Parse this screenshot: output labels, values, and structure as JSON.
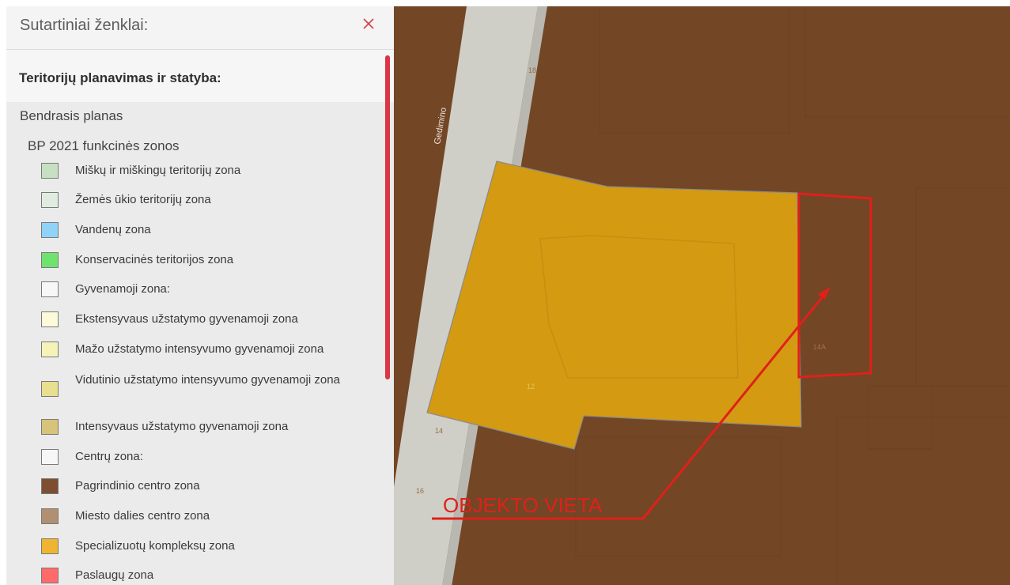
{
  "panel": {
    "title": "Sutartiniai ženklai:",
    "section": "Teritorijų planavimas ir statyba:",
    "group": "Bendrasis planas",
    "subgroup": "BP 2021 funkcinės zonos",
    "close_icon": "close-icon"
  },
  "legend": [
    {
      "label": "Miškų ir miškingų teritorijų zona",
      "color": "#c8e0c2"
    },
    {
      "label": "Žemės ūkio teritorijų zona",
      "color": "#e1ece0"
    },
    {
      "label": "Vandenų zona",
      "color": "#8fd4f8"
    },
    {
      "label": "Konservacinės teritorijos zona",
      "color": "#6fe36f"
    },
    {
      "label": "Gyvenamoji zona:",
      "color": "#f7f7f7"
    },
    {
      "label": "Ekstensyvaus užstatymo gyvenamoji zona",
      "color": "#fbfbd9"
    },
    {
      "label": "Mažo užstatymo intensyvumo gyvenamoji zona",
      "color": "#f6f3b8"
    },
    {
      "label": "Vidutinio užstatymo intensyvumo gyvenamoji zona",
      "color": "#e8df8f"
    },
    {
      "label": "Intensyvaus užstatymo gyvenamoji zona",
      "color": "#d8c37a"
    },
    {
      "label": "Centrų zona:",
      "color": "#f7f7f7"
    },
    {
      "label": "Pagrindinio centro zona",
      "color": "#7d4e32"
    },
    {
      "label": "Miesto dalies centro zona",
      "color": "#b09070"
    },
    {
      "label": "Specializuotų kompleksų zona",
      "color": "#f0b432"
    },
    {
      "label": "Paslaugų zona",
      "color": "#ff6b6b"
    }
  ],
  "map": {
    "street_label": "Gedimino",
    "parcel_labels": [
      "18",
      "14A",
      "12",
      "14",
      "16"
    ],
    "annotation": "OBJEKTO VIETA",
    "annotation_color": "#e0201a",
    "zone_color": "#d39a12",
    "road_color": "#cfcfc8"
  }
}
